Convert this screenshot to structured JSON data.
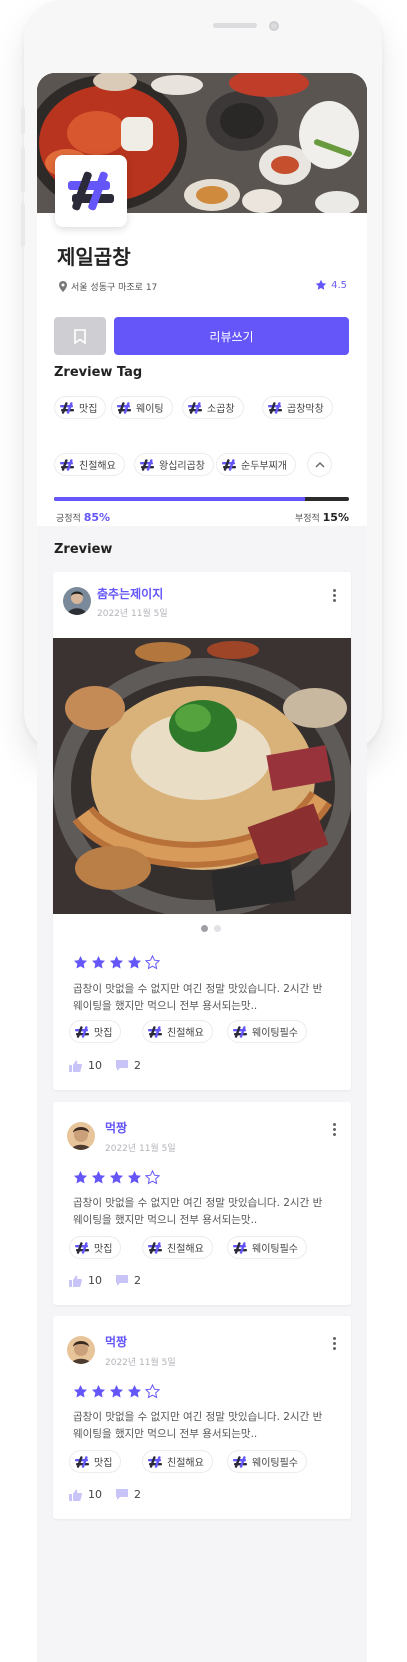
{
  "restaurant": {
    "name": "제일곱창",
    "address": "서울 성동구 마조로 17",
    "rating": "4.5"
  },
  "actions": {
    "write_review": "리뷰쓰기"
  },
  "tags_section": {
    "title": "Zreview Tag",
    "tags": [
      "맛집",
      "웨이팅",
      "소곱창",
      "곱창막창",
      "친절해요",
      "왕십리곱창",
      "순두부찌개"
    ]
  },
  "sentiment": {
    "positive_label": "긍정적",
    "positive_value": "85%",
    "negative_label": "부정적",
    "negative_value": "15%",
    "positive_fraction": 0.85
  },
  "reviews_section": {
    "title": "Zreview"
  },
  "reviews": [
    {
      "user": "춤추는제이지",
      "date": "2022년 11월 5일",
      "stars": 4,
      "text": "곱창이 맛없을 수 없지만 여긴 정말 맛있습니다. 2시간 반 웨이팅을 했지만 먹으니 전부 용서되는맛..",
      "tags": [
        "맛집",
        "친절해요",
        "웨이팅필수"
      ],
      "likes": "10",
      "comments": "2"
    },
    {
      "user": "먹짱",
      "date": "2022년 11월 5일",
      "stars": 4,
      "text": "곱창이 맛없을 수 없지만 여긴 정말 맛있습니다. 2시간 반 웨이팅을 했지만 먹으니 전부 용서되는맛..",
      "tags": [
        "맛집",
        "친절해요",
        "웨이팅필수"
      ],
      "likes": "10",
      "comments": "2"
    },
    {
      "user": "먹짱",
      "date": "2022년 11월 5일",
      "stars": 4,
      "text": "곱창이 맛없을 수 없지만 여긴 정말 맛있습니다. 2시간 반 웨이팅을 했지만 먹으니 전부 용서되는맛..",
      "tags": [
        "맛집",
        "친절해요",
        "웨이팅필수"
      ],
      "likes": "10",
      "comments": "2"
    }
  ],
  "colors": {
    "accent": "#6456f8",
    "bookmark_bg": "#cfcfd3"
  }
}
